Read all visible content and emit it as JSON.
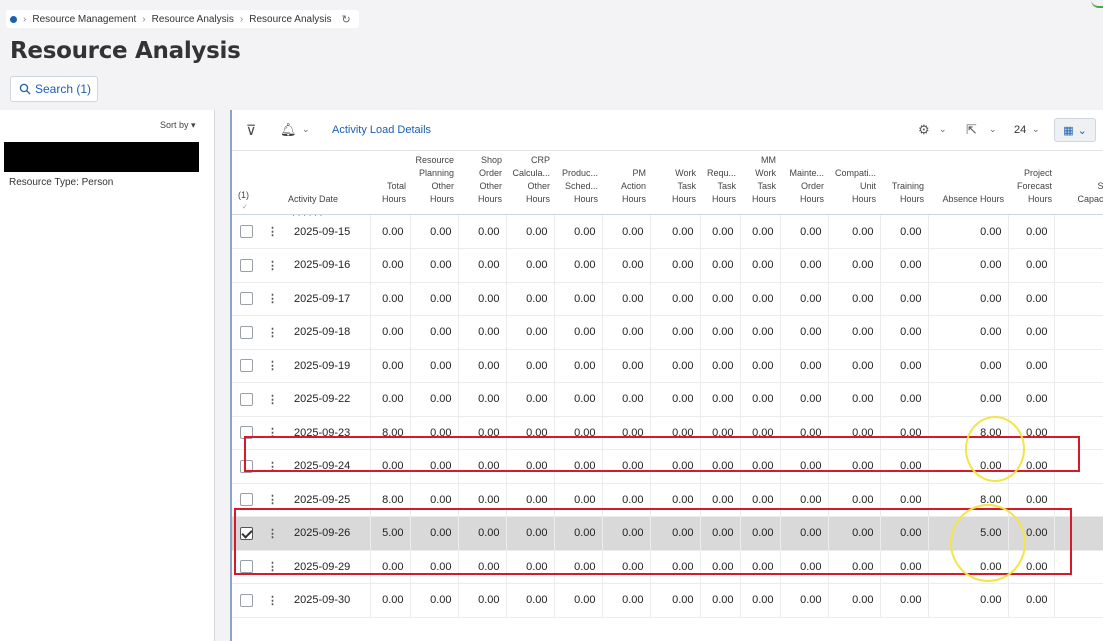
{
  "breadcrumb": {
    "items": [
      "Resource Management",
      "Resource Analysis",
      "Resource Analysis"
    ]
  },
  "page": {
    "title": "Resource Analysis"
  },
  "search": {
    "label": "Search (1)"
  },
  "left_panel": {
    "sort_label": "Sort by",
    "resource_type": "Resource Type:  Person"
  },
  "toolbar": {
    "activity_link": "Activity Load Details",
    "page_size": "24"
  },
  "grid": {
    "selection_count": "(1)",
    "headers": [
      {
        "key": "date",
        "label": "Activity Date"
      },
      {
        "key": "total",
        "label": "Total\nHours"
      },
      {
        "key": "rp",
        "label": "Resource\nPlanning\nOther\nHours"
      },
      {
        "key": "so",
        "label": "Shop\nOrder\nOther\nHours"
      },
      {
        "key": "crp",
        "label": "CRP\nCalcula...\nOther\nHours"
      },
      {
        "key": "prod",
        "label": "Produc...\nSched...\nHours"
      },
      {
        "key": "pm",
        "label": "PM\nAction\nHours"
      },
      {
        "key": "wt",
        "label": "Work\nTask\nHours"
      },
      {
        "key": "rt",
        "label": "Requ...\nTask\nHours"
      },
      {
        "key": "mm",
        "label": "MM\nWork\nTask\nHours"
      },
      {
        "key": "mo",
        "label": "Mainte...\nOrder\nHours"
      },
      {
        "key": "cu",
        "label": "Compati...\nUnit\nHours"
      },
      {
        "key": "tr",
        "label": "Training\nHours"
      },
      {
        "key": "ab",
        "label": "Absence Hours"
      },
      {
        "key": "pf",
        "label": "Project\nForecast\nHours"
      },
      {
        "key": "sc",
        "label": "Sc\nCapacit"
      }
    ],
    "rows": [
      {
        "date": "2025-09-15",
        "total": "0.00",
        "absence": "0.00",
        "forecast": "0.00",
        "checked": false
      },
      {
        "date": "2025-09-16",
        "total": "0.00",
        "absence": "0.00",
        "forecast": "0.00",
        "checked": false
      },
      {
        "date": "2025-09-17",
        "total": "0.00",
        "absence": "0.00",
        "forecast": "0.00",
        "checked": false
      },
      {
        "date": "2025-09-18",
        "total": "0.00",
        "absence": "0.00",
        "forecast": "0.00",
        "checked": false
      },
      {
        "date": "2025-09-19",
        "total": "0.00",
        "absence": "0.00",
        "forecast": "0.00",
        "checked": false
      },
      {
        "date": "2025-09-22",
        "total": "0.00",
        "absence": "0.00",
        "forecast": "0.00",
        "checked": false
      },
      {
        "date": "2025-09-23",
        "total": "8.00",
        "absence": "8.00",
        "forecast": "0.00",
        "checked": false
      },
      {
        "date": "2025-09-24",
        "total": "0.00",
        "absence": "0.00",
        "forecast": "0.00",
        "checked": false
      },
      {
        "date": "2025-09-25",
        "total": "8.00",
        "absence": "8.00",
        "forecast": "0.00",
        "checked": false
      },
      {
        "date": "2025-09-26",
        "total": "5.00",
        "absence": "5.00",
        "forecast": "0.00",
        "checked": true
      },
      {
        "date": "2025-09-29",
        "total": "0.00",
        "absence": "0.00",
        "forecast": "0.00",
        "checked": false
      },
      {
        "date": "2025-09-30",
        "total": "0.00",
        "absence": "0.00",
        "forecast": "0.00",
        "checked": false
      }
    ],
    "other_value": "0.00"
  },
  "annotations": {
    "box_color": "#d8192a",
    "circle_color": "#f3e44a"
  }
}
